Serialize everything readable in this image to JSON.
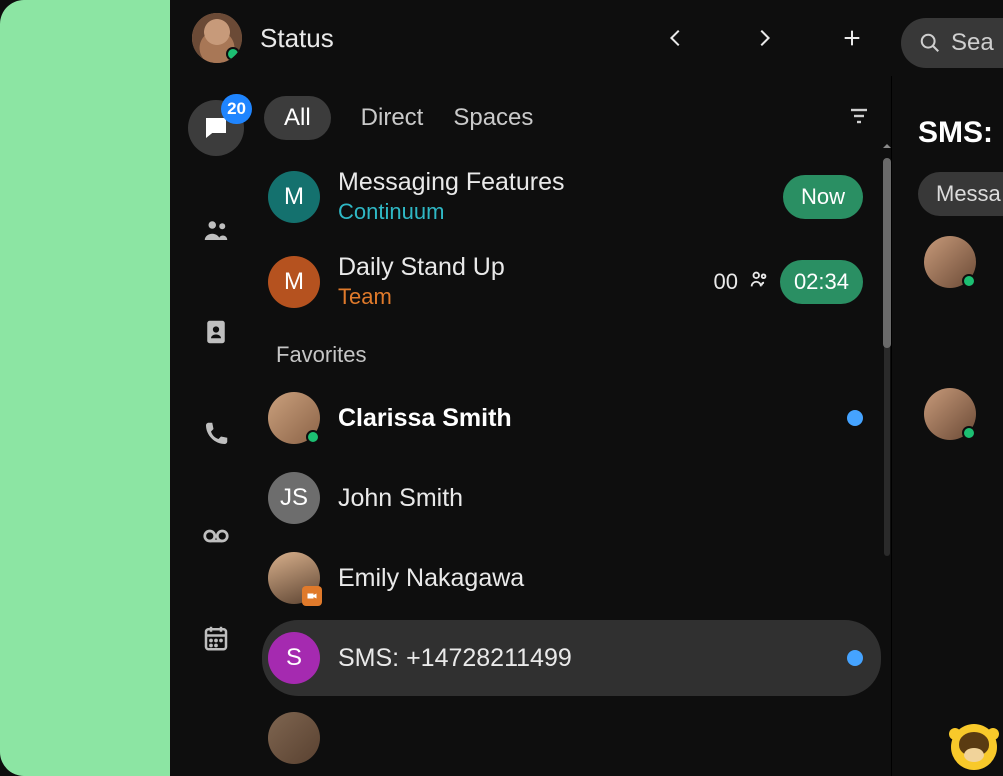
{
  "header": {
    "status_label": "Status",
    "search_placeholder": "Sea"
  },
  "rail": {
    "messages_badge": "20"
  },
  "tabs": {
    "all": "All",
    "direct": "Direct",
    "spaces": "Spaces"
  },
  "sections": {
    "favorites": "Favorites"
  },
  "conversations": {
    "feature": {
      "title": "Messaging Features",
      "subtitle": "Continuum",
      "badge": "Now",
      "avatar_letter": "M"
    },
    "standup": {
      "title": "Daily Stand Up",
      "subtitle": "Team",
      "count": "00",
      "time": "02:34",
      "avatar_letter": "M"
    },
    "clarissa": {
      "title": "Clarissa Smith"
    },
    "john": {
      "title": "John Smith",
      "avatar_letters": "JS"
    },
    "emily": {
      "title": "Emily Nakagawa"
    },
    "sms": {
      "title": "SMS: +14728211499",
      "avatar_letter": "S"
    }
  },
  "right_panel": {
    "title": "SMS:",
    "chip": "Messa"
  }
}
